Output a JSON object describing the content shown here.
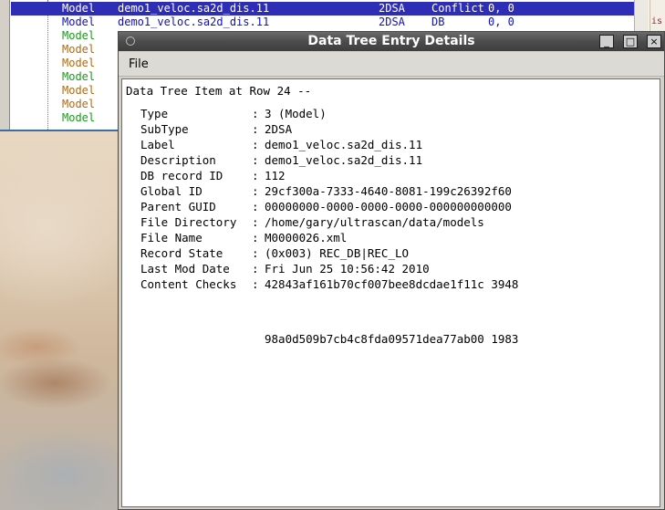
{
  "background_tree": {
    "rows": [
      {
        "type": "Model",
        "label": "demo1_veloc.sa2d_dis.11",
        "subtype": "2DSA",
        "source": "Conflict",
        "nums": "0, 0",
        "selected": true,
        "color": "#ffffff"
      },
      {
        "type": "Model",
        "label": "demo1_veloc.sa2d_dis.11",
        "subtype": "2DSA",
        "source": "DB",
        "nums": "0, 0",
        "selected": false,
        "color": "#1010c0"
      },
      {
        "type": "Model",
        "label": "",
        "subtype": "",
        "source": "",
        "nums": "",
        "selected": false,
        "color": "#1a9a1a"
      },
      {
        "type": "Model",
        "label": "",
        "subtype": "",
        "source": "",
        "nums": "",
        "selected": false,
        "color": "#b06a10"
      },
      {
        "type": "Model",
        "label": "",
        "subtype": "",
        "source": "",
        "nums": "",
        "selected": false,
        "color": "#b06a10"
      },
      {
        "type": "Model",
        "label": "",
        "subtype": "",
        "source": "",
        "nums": "",
        "selected": false,
        "color": "#1a9a1a"
      },
      {
        "type": "Model",
        "label": "",
        "subtype": "",
        "source": "",
        "nums": "",
        "selected": false,
        "color": "#b06a10"
      },
      {
        "type": "Model",
        "label": "",
        "subtype": "",
        "source": "",
        "nums": "",
        "selected": false,
        "color": "#b06a10"
      },
      {
        "type": "Model",
        "label": "",
        "subtype": "",
        "source": "",
        "nums": "",
        "selected": false,
        "color": "#1a9a1a"
      }
    ],
    "right_edge_fragment": "is"
  },
  "dialog": {
    "title": "Data Tree Entry Details",
    "menu": {
      "file_label": "File"
    },
    "buttons": {
      "minimize": "_",
      "maximize": "□",
      "close": "×"
    },
    "content": {
      "header": "Data Tree Item at Row 24 --",
      "separator": ":",
      "fields": [
        {
          "key": "Type",
          "value": "3 (Model)"
        },
        {
          "key": "SubType",
          "value": "2DSA"
        },
        {
          "key": "Label",
          "value": "demo1_veloc.sa2d_dis.11"
        },
        {
          "key": "Description",
          "value": "demo1_veloc.sa2d_dis.11"
        },
        {
          "key": "DB record ID",
          "value": "112"
        },
        {
          "key": "Global ID",
          "value": "29cf300a-7333-4640-8081-199c26392f60"
        },
        {
          "key": "Parent GUID",
          "value": "00000000-0000-0000-0000-000000000000"
        },
        {
          "key": "File Directory",
          "value": "/home/gary/ultrascan/data/models"
        },
        {
          "key": "File Name",
          "value": "M0000026.xml"
        },
        {
          "key": "Record State",
          "value": "(0x003) REC_DB|REC_LO"
        },
        {
          "key": "Last Mod Date",
          "value": "Fri Jun 25 10:56:42 2010"
        },
        {
          "key": "Content Checks",
          "value": "42843af161b70cf007bee8dcdae1f11c 3948"
        }
      ],
      "continuation": "98a0d509b7cb4c8fda09571dea77ab00 1983"
    }
  }
}
